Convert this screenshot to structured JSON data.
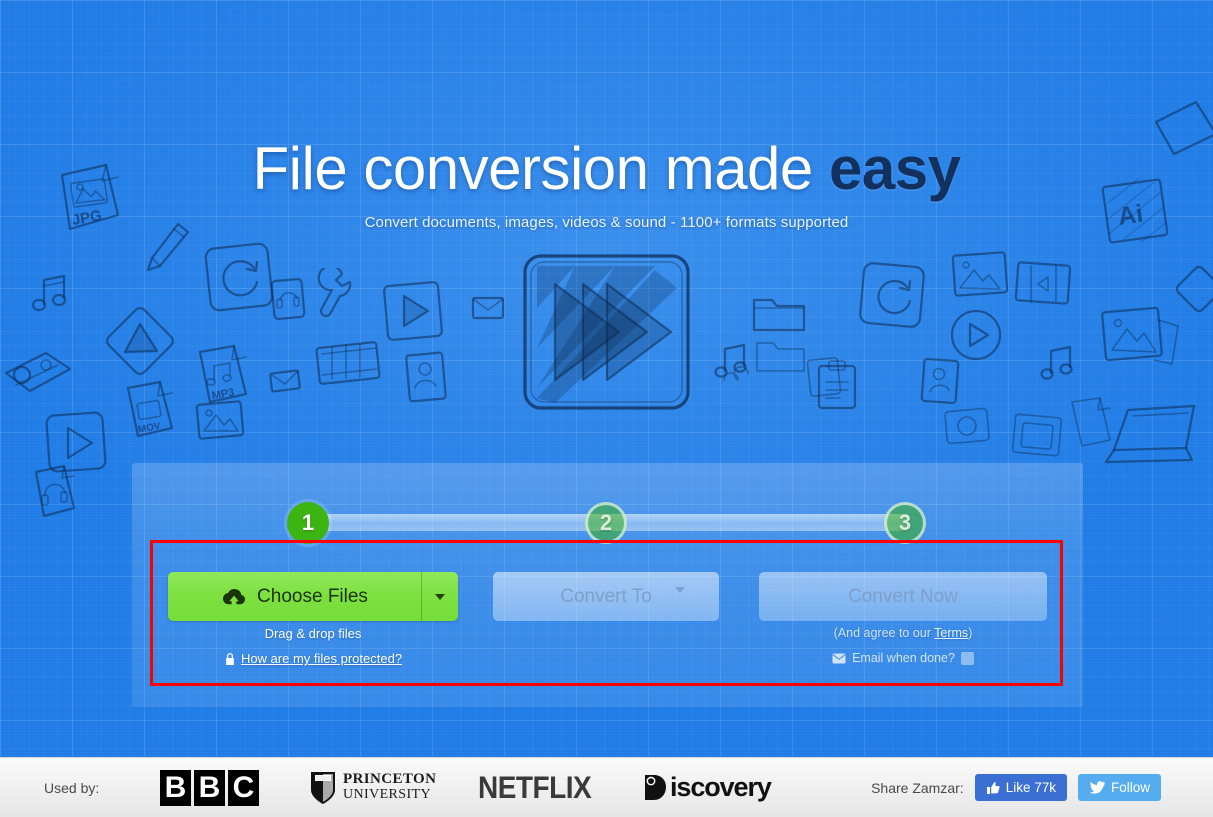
{
  "hero": {
    "title_main": "File conversion made",
    "title_accent": "easy",
    "subtitle": "Convert documents, images, videos & sound - 1100+ formats supported"
  },
  "converter": {
    "steps": [
      {
        "number": "1",
        "state": "active"
      },
      {
        "number": "2",
        "state": "idle"
      },
      {
        "number": "3",
        "state": "idle"
      }
    ],
    "choose_files_label": "Choose Files",
    "choose_files_icon": "cloud-upload-icon",
    "choose_files_caret_icon": "chevron-down-icon",
    "convert_to_label": "Convert To",
    "convert_to_caret_icon": "chevron-down-icon",
    "convert_now_label": "Convert Now",
    "drag_drop_text": "Drag & drop files",
    "protected_icon": "lock-icon",
    "protected_link": "How are my files protected?",
    "terms_prefix": "(And agree to our ",
    "terms_link": "Terms",
    "terms_suffix": ")",
    "email_icon": "envelope-icon",
    "email_label": "Email when done?",
    "email_checked": false
  },
  "footer": {
    "used_by_label": "Used by:",
    "logos": [
      {
        "name": "bbc",
        "letters": [
          "B",
          "B",
          "C"
        ]
      },
      {
        "name": "princeton",
        "line1": "PRINCETON",
        "line2": "UNIVERSITY"
      },
      {
        "name": "netflix",
        "text": "NETFLIX"
      },
      {
        "name": "discovery",
        "text": "iscovery"
      }
    ],
    "share_label": "Share Zamzar:",
    "facebook": {
      "icon": "thumbs-up-icon",
      "label": "Like 77k"
    },
    "twitter": {
      "icon": "twitter-bird-icon",
      "label": "Follow"
    }
  },
  "colors": {
    "hero_background": "#1e7ce9",
    "title_accent": "#12315f",
    "choose_files_green": "#7ce03f",
    "step_active_green": "#3cb512",
    "annotation_red": "#fc0000",
    "facebook_blue": "#3b6fd4",
    "twitter_blue": "#55acee"
  },
  "doodle_labels": {
    "jpg": "JPG",
    "mp3": "MP3",
    "mov": "MOV",
    "ai": "Ai"
  }
}
